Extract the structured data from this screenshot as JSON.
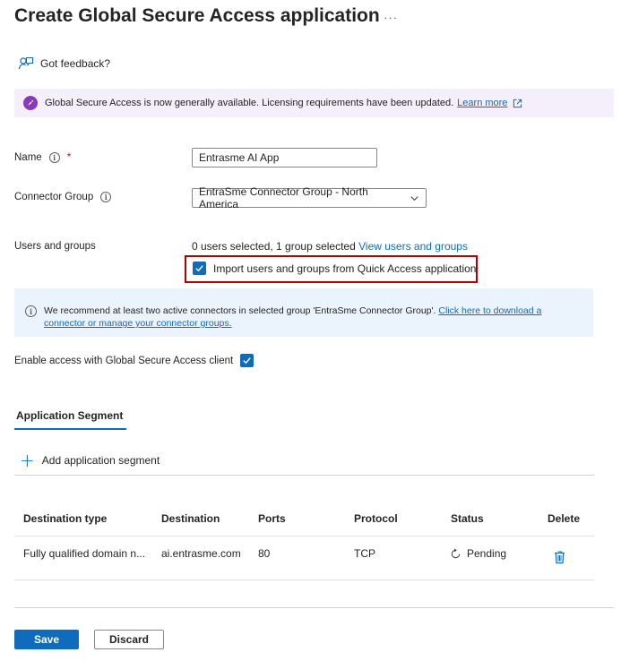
{
  "page": {
    "title": "Create Global Secure Access application",
    "more_label": "···"
  },
  "feedback": {
    "label": "Got feedback?",
    "icon": "feedback-icon"
  },
  "banner": {
    "text": "Global Secure Access is now generally available. Licensing requirements have been updated.",
    "link": "Learn more",
    "icon": "rocket-icon",
    "accent": "#8a3ab9"
  },
  "form": {
    "name_label": "Name",
    "required_marker": "*",
    "name_value": "Entrasme AI App",
    "connector_label": "Connector Group",
    "connector_value": "EntraSme Connector Group - North America",
    "users_label": "Users and groups",
    "users_summary": "0 users selected, 1 group selected",
    "users_link": "View users and groups",
    "import_label": "Import users and groups from Quick Access application",
    "import_checked": true
  },
  "info": {
    "text": "We recommend at least two active connectors in selected group 'EntraSme Connector Group'.",
    "link": "Click here to download a connector or manage your connector groups."
  },
  "client": {
    "label": "Enable access with Global Secure Access client",
    "checked": true
  },
  "segment": {
    "tab_label": "Application Segment",
    "add_label": "Add application segment",
    "headers": [
      "Destination type",
      "Destination",
      "Ports",
      "Protocol",
      "Status",
      "Delete"
    ],
    "rows": [
      {
        "destination_type": "Fully qualified domain n...",
        "destination": "ai.entrasme.com",
        "ports": "80",
        "protocol": "TCP",
        "status": "Pending"
      }
    ]
  },
  "actions": {
    "save": "Save",
    "discard": "Discard"
  },
  "colors": {
    "primary": "#0f6cbd",
    "highlight": "#b00000",
    "info_bg": "#ebf3fc",
    "banner_bg": "#f5eefb"
  }
}
